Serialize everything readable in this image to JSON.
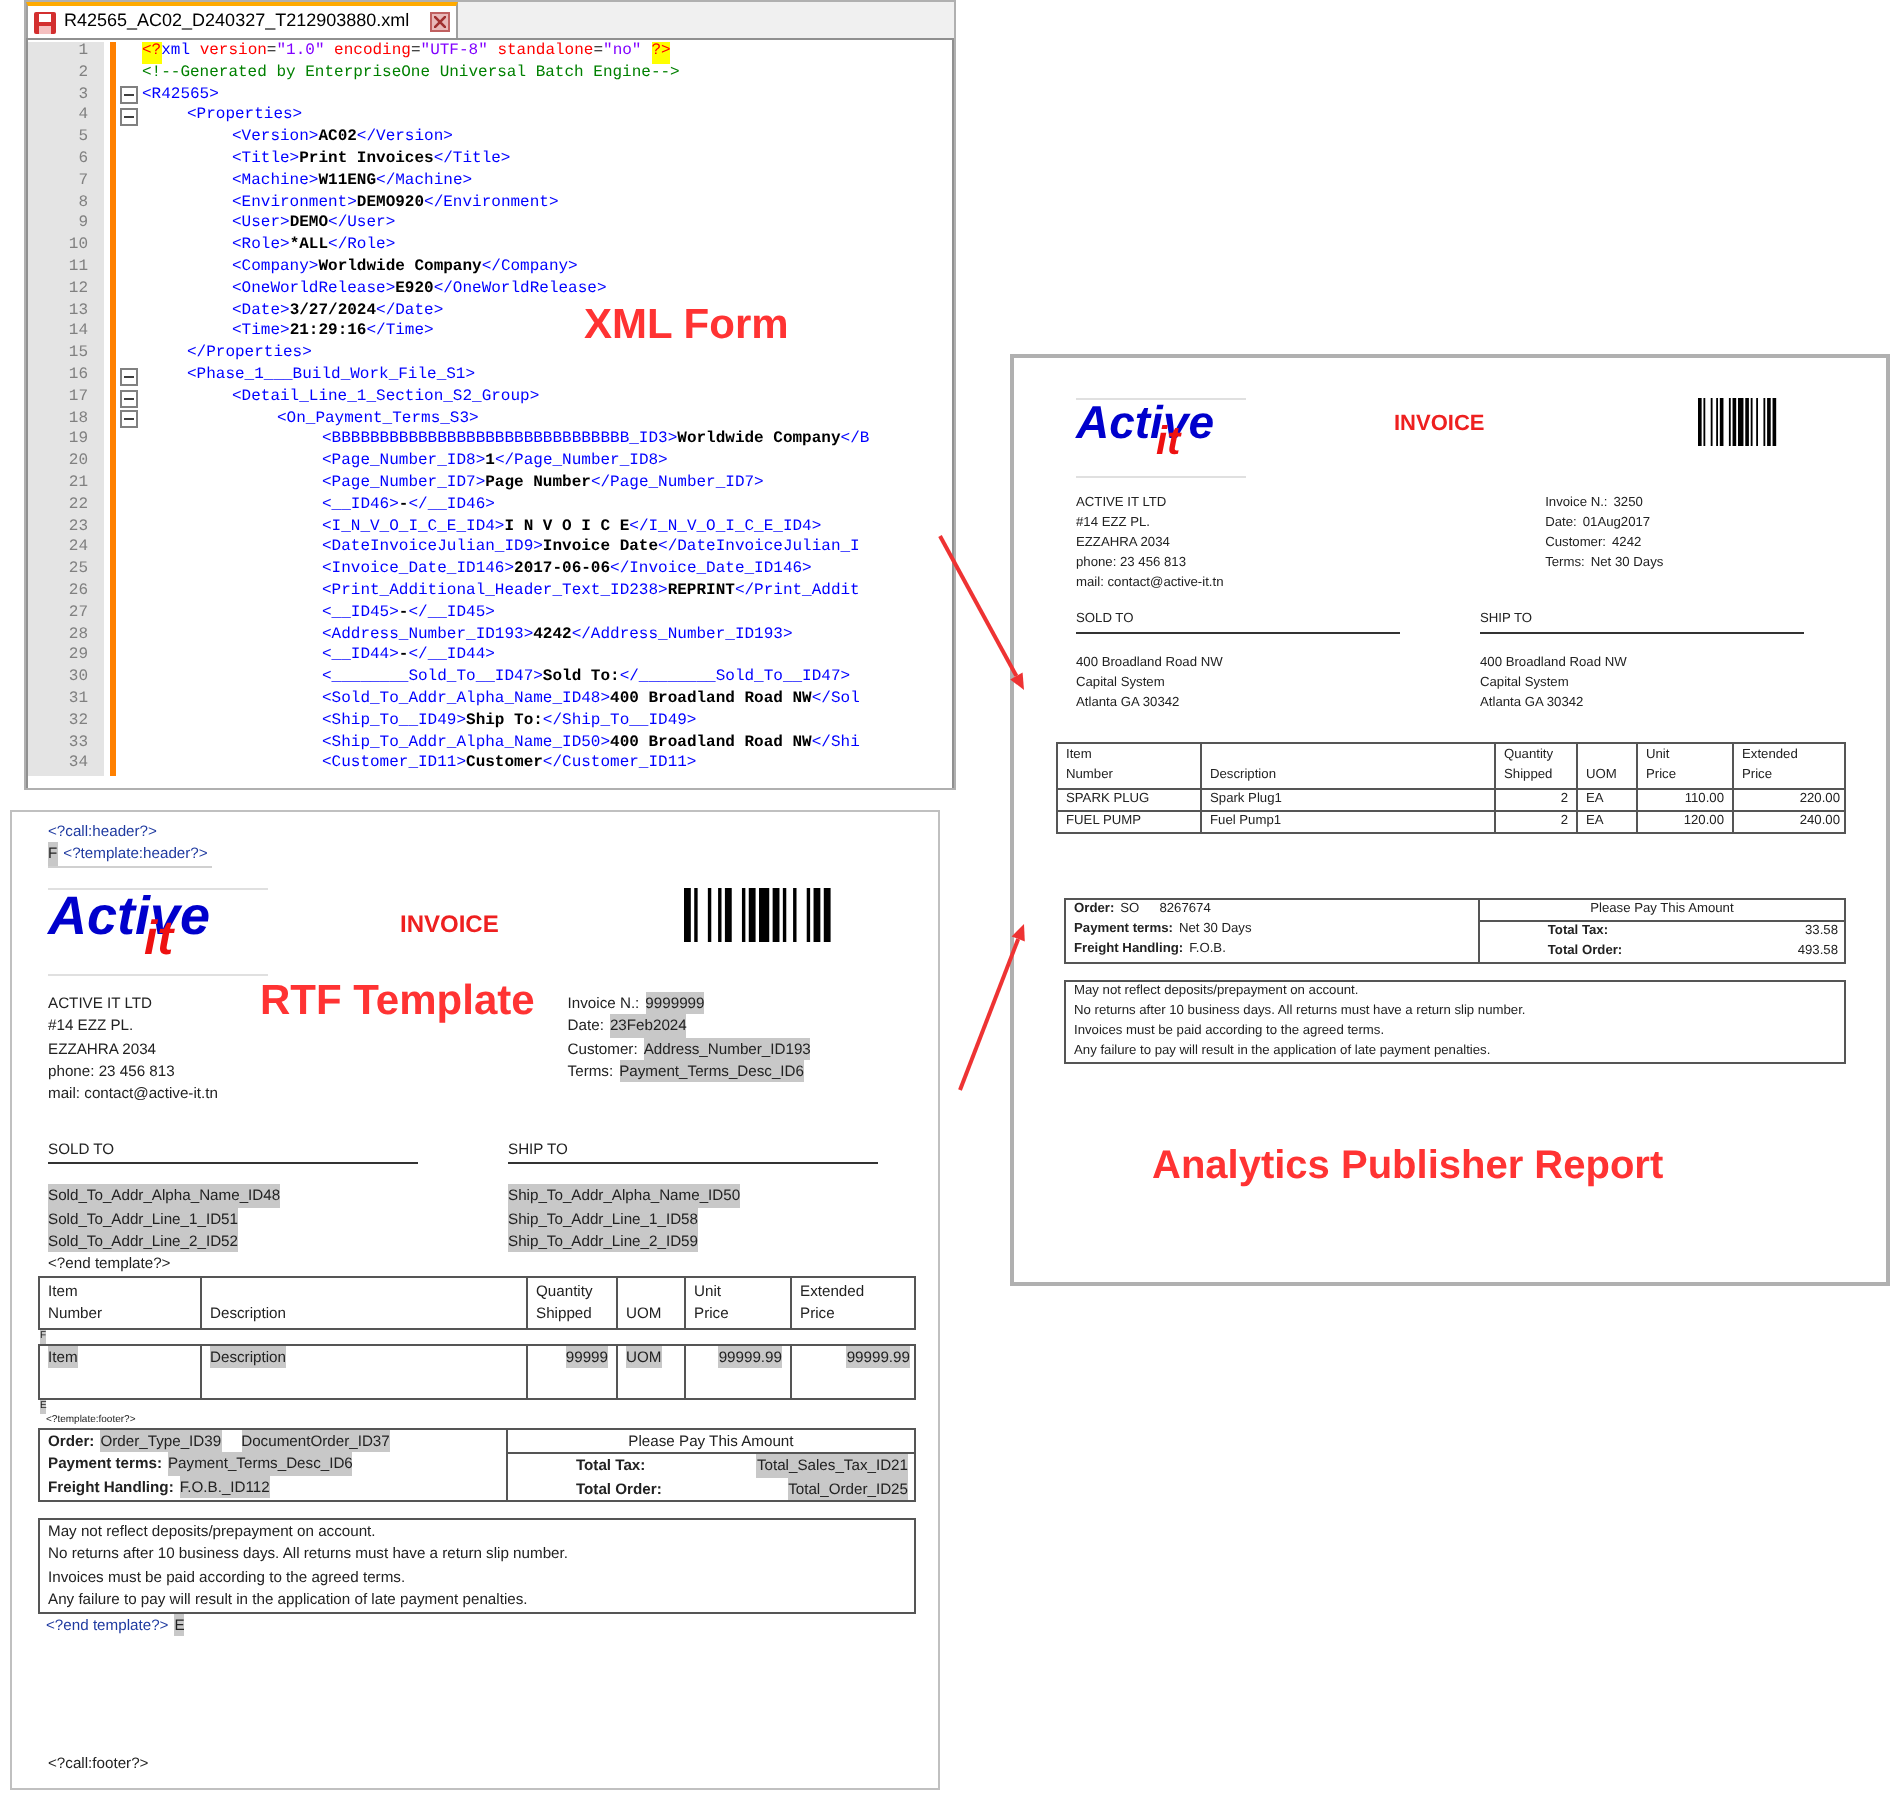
{
  "xml_editor": {
    "tab": {
      "title": "R42565_AC02_D240327_T212903880.xml",
      "selected": true
    },
    "overlay_label": "XML Form",
    "nodes": [
      {
        "number": "1",
        "kind": "decl",
        "open_mark": "<?",
        "name": "xml",
        "attributes": [
          {
            "name": "version",
            "equals": "=",
            "value": "\"1.0\""
          },
          {
            "name": "encoding",
            "equals": "=",
            "value": "\"UTF-8\""
          },
          {
            "name": "standalone",
            "equals": "=",
            "value": "\"no\""
          }
        ],
        "close_mark": "?>"
      },
      {
        "number": "2",
        "kind": "comment",
        "text": "<!--Generated by EnterpriseOne Universal Batch Engine-->"
      },
      {
        "number": "3",
        "kind": "element",
        "open": "<R42565>",
        "expanded": true,
        "children": [
          {
            "number": "4",
            "kind": "element",
            "open": "<Properties>",
            "expanded": true,
            "children": [
              {
                "number": "5",
                "kind": "element",
                "open": "<Version>",
                "text": "AC02",
                "close": "</Version>"
              },
              {
                "number": "6",
                "kind": "element",
                "open": "<Title>",
                "text": "Print Invoices",
                "close": "</Title>"
              },
              {
                "number": "7",
                "kind": "element",
                "open": "<Machine>",
                "text": "W11ENG",
                "close": "</Machine>"
              },
              {
                "number": "8",
                "kind": "element",
                "open": "<Environment>",
                "text": "DEMO920",
                "close": "</Environment>"
              },
              {
                "number": "9",
                "kind": "element",
                "open": "<User>",
                "text": "DEMO",
                "close": "</User>"
              },
              {
                "number": "10",
                "kind": "element",
                "open": "<Role>",
                "text": "*ALL",
                "close": "</Role>"
              },
              {
                "number": "11",
                "kind": "element",
                "open": "<Company>",
                "text": "Worldwide Company",
                "close": "</Company>"
              },
              {
                "number": "12",
                "kind": "element",
                "open": "<OneWorldRelease>",
                "text": "E920",
                "close": "</OneWorldRelease>"
              },
              {
                "number": "13",
                "kind": "element",
                "open": "<Date>",
                "text": "3/27/2024",
                "close": "</Date>"
              },
              {
                "number": "14",
                "kind": "element",
                "open": "<Time>",
                "text": "21:29:16",
                "close": "</Time>"
              }
            ],
            "end": {
              "number": "15",
              "text": "</Properties>"
            }
          },
          {
            "number": "16",
            "kind": "element",
            "open": "<Phase_1___Build_Work_File_S1>",
            "expanded": true,
            "children": [
              {
                "number": "17",
                "kind": "element",
                "open": "<Detail_Line_1_Section_S2_Group>",
                "expanded": true,
                "children": [
                  {
                    "number": "18",
                    "kind": "element",
                    "open": "<On_Payment_Terms_S3>",
                    "expanded": true,
                    "children": [
                      {
                        "number": "19",
                        "kind": "element",
                        "open": "<BBBBBBBBBBBBBBBBBBBBBBBBBBBBBBB_ID3>",
                        "text": "Worldwide Company",
                        "close": "</B"
                      },
                      {
                        "number": "20",
                        "kind": "element",
                        "open": "<Page_Number_ID8>",
                        "text": "1",
                        "close": "</Page_Number_ID8>"
                      },
                      {
                        "number": "21",
                        "kind": "element",
                        "open": "<Page_Number_ID7>",
                        "text": "Page Number",
                        "close": "</Page_Number_ID7>"
                      },
                      {
                        "number": "22",
                        "kind": "element",
                        "open": "<__ID46>",
                        "text": "-",
                        "close": "</__ID46>"
                      },
                      {
                        "number": "23",
                        "kind": "element",
                        "open": "<I_N_V_O_I_C_E_ID4>",
                        "text": "I N V O I C E",
                        "close": "</I_N_V_O_I_C_E_ID4>"
                      },
                      {
                        "number": "24",
                        "kind": "element",
                        "open": "<DateInvoiceJulian_ID9>",
                        "text": "Invoice Date",
                        "close": "</DateInvoiceJulian_I"
                      },
                      {
                        "number": "25",
                        "kind": "element",
                        "open": "<Invoice_Date_ID146>",
                        "text": "2017-06-06",
                        "close": "</Invoice_Date_ID146>"
                      },
                      {
                        "number": "26",
                        "kind": "element",
                        "open": "<Print_Additional_Header_Text_ID238>",
                        "text": "REPRINT",
                        "close": "</Print_Addit"
                      },
                      {
                        "number": "27",
                        "kind": "element",
                        "open": "<__ID45>",
                        "text": "-",
                        "close": "</__ID45>"
                      },
                      {
                        "number": "28",
                        "kind": "element",
                        "open": "<Address_Number_ID193>",
                        "text": "4242",
                        "close": "</Address_Number_ID193>"
                      },
                      {
                        "number": "29",
                        "kind": "element",
                        "open": "<__ID44>",
                        "text": "-",
                        "close": "</__ID44>"
                      },
                      {
                        "number": "30",
                        "kind": "element",
                        "open": "<________Sold_To__ID47>",
                        "text": "Sold To:",
                        "close": "</________Sold_To__ID47>"
                      },
                      {
                        "number": "31",
                        "kind": "element",
                        "open": "<Sold_To_Addr_Alpha_Name_ID48>",
                        "text": "400 Broadland Road NW",
                        "close": "</Sol"
                      },
                      {
                        "number": "32",
                        "kind": "element",
                        "open": "<Ship_To__ID49>",
                        "text": "Ship To:",
                        "close": "</Ship_To__ID49>"
                      },
                      {
                        "number": "33",
                        "kind": "element",
                        "open": "<Ship_To_Addr_Alpha_Name_ID50>",
                        "text": "400 Broadland Road NW",
                        "close": "</Shi"
                      },
                      {
                        "number": "34",
                        "kind": "element",
                        "open": "<Customer_ID11>",
                        "text": "Customer",
                        "close": "</Customer_ID11>"
                      }
                    ]
                  }
                ]
              }
            ]
          }
        ]
      }
    ]
  },
  "rtf_template": {
    "overlay_label": "RTF Template",
    "call_header": "<?call:header?>",
    "template_header": {
      "mark": "F",
      "tag": "<?template:header?>"
    },
    "logo": {
      "word": "Active",
      "sub": "it"
    },
    "heading": "INVOICE",
    "company_lines": [
      "ACTIVE IT LTD",
      "#14 EZZ PL.",
      "EZZAHRA 2034",
      "phone: 23 456 813",
      "mail: contact@active-it.tn"
    ],
    "info": [
      {
        "label": "Invoice N.:",
        "value": "9999999",
        "field": true
      },
      {
        "label": "Date:",
        "value": "23Feb2024",
        "field": true
      },
      {
        "label": "Customer:",
        "value": "Address_Number_ID193",
        "field": true
      },
      {
        "label": "Terms:",
        "value": "Payment_Terms_Desc_ID6",
        "field": true
      }
    ],
    "sold_to": {
      "heading": "SOLD TO",
      "lines": [
        {
          "text": "Sold_To_Addr_Alpha_Name_ID48",
          "field": true
        },
        {
          "text": "Sold_To_Addr_Line_1_ID51",
          "field": true
        },
        {
          "text": "Sold_To_Addr_Line_2_ID52",
          "field": true
        }
      ]
    },
    "ship_to": {
      "heading": "SHIP TO",
      "lines": [
        {
          "text": "Ship_To_Addr_Alpha_Name_ID50",
          "field": true
        },
        {
          "text": "Ship_To_Addr_Line_1_ID58",
          "field": true
        },
        {
          "text": "Ship_To_Addr_Line_2_ID59",
          "field": true
        }
      ]
    },
    "end_template": "<?end template?>",
    "columns": [
      {
        "lines": [
          "Item",
          "Number"
        ],
        "kind": "text"
      },
      {
        "lines": [
          "Description"
        ],
        "kind": "text"
      },
      {
        "lines": [
          "Quantity",
          "Shipped"
        ],
        "kind": "number"
      },
      {
        "lines": [
          "UOM"
        ],
        "kind": "text"
      },
      {
        "lines": [
          "Unit",
          "Price"
        ],
        "kind": "number"
      },
      {
        "lines": [
          "Extended",
          "Price"
        ],
        "kind": "number"
      }
    ],
    "row_start_mark": "F",
    "rows": [
      {
        "cells": [
          {
            "text": "Item",
            "field": true
          },
          {
            "text": "Description",
            "field": true
          },
          {
            "text": "99999",
            "field": true
          },
          {
            "text": "UOM",
            "field": true
          },
          {
            "text": "99999.99",
            "field": true
          },
          {
            "text": "99999.99",
            "field": true
          }
        ]
      }
    ],
    "row_end_mark": "E",
    "template_footer": "<?template:footer?>",
    "summary": {
      "order": {
        "label": "Order:",
        "values": [
          {
            "text": "Order_Type_ID39",
            "field": true
          },
          {
            "text": "DocumentOrder_ID37",
            "field": true
          }
        ]
      },
      "payment": {
        "label": "Payment terms:",
        "values": [
          {
            "text": "Payment_Terms_Desc_ID6",
            "field": true
          }
        ]
      },
      "freight": {
        "label": "Freight Handling:",
        "values": [
          {
            "text": "F.O.B._ID112",
            "field": true
          }
        ]
      },
      "pay_heading": "Please Pay This Amount",
      "totals": [
        {
          "label": "Total Tax:",
          "value": {
            "text": "Total_Sales_Tax_ID21",
            "field": true
          }
        },
        {
          "label": "Total Order:",
          "value": {
            "text": "Total_Order_ID25",
            "field": true
          }
        }
      ]
    },
    "notes": [
      "May not reflect deposits/prepayment on account.",
      "No returns after 10 business days. All returns must have a return slip number.",
      "Invoices must be paid according to the agreed terms.",
      "Any failure to pay will result in the application of late payment penalties."
    ],
    "end_template_footer": {
      "tag": "<?end template?>",
      "mark": "E"
    },
    "call_footer": "<?call:footer?>"
  },
  "report": {
    "overlay_label": "Analytics Publisher Report",
    "logo": {
      "word": "Active",
      "sub": "it"
    },
    "heading": "INVOICE",
    "company_lines": [
      "ACTIVE IT LTD",
      "#14 EZZ PL.",
      "EZZAHRA 2034",
      "phone: 23 456 813",
      "mail: contact@active-it.tn"
    ],
    "info": [
      {
        "label": "Invoice N.:",
        "value": "3250",
        "field": false
      },
      {
        "label": "Date:",
        "value": "01Aug2017",
        "field": false
      },
      {
        "label": "Customer:",
        "value": "4242",
        "field": false
      },
      {
        "label": "Terms:",
        "value": "Net 30 Days",
        "field": false
      }
    ],
    "sold_to": {
      "heading": "SOLD TO",
      "lines": [
        {
          "text": "400 Broadland Road NW",
          "field": false
        },
        {
          "text": "Capital System",
          "field": false
        },
        {
          "text": "Atlanta GA 30342",
          "field": false
        }
      ]
    },
    "ship_to": {
      "heading": "SHIP TO",
      "lines": [
        {
          "text": "400 Broadland Road NW",
          "field": false
        },
        {
          "text": "Capital System",
          "field": false
        },
        {
          "text": "Atlanta GA 30342",
          "field": false
        }
      ]
    },
    "columns": [
      {
        "lines": [
          "Item",
          "Number"
        ],
        "kind": "text"
      },
      {
        "lines": [
          "Description"
        ],
        "kind": "text"
      },
      {
        "lines": [
          "Quantity",
          "Shipped"
        ],
        "kind": "number"
      },
      {
        "lines": [
          "UOM"
        ],
        "kind": "text"
      },
      {
        "lines": [
          "Unit",
          "Price"
        ],
        "kind": "number"
      },
      {
        "lines": [
          "Extended",
          "Price"
        ],
        "kind": "number"
      }
    ],
    "rows": [
      {
        "cells": [
          {
            "text": "SPARK PLUG",
            "field": false
          },
          {
            "text": "Spark Plug1",
            "field": false
          },
          {
            "text": "2",
            "field": false
          },
          {
            "text": "EA",
            "field": false
          },
          {
            "text": "110.00",
            "field": false
          },
          {
            "text": "220.00",
            "field": false
          }
        ]
      },
      {
        "cells": [
          {
            "text": "FUEL PUMP",
            "field": false
          },
          {
            "text": "Fuel Pump1",
            "field": false
          },
          {
            "text": "2",
            "field": false
          },
          {
            "text": "EA",
            "field": false
          },
          {
            "text": "120.00",
            "field": false
          },
          {
            "text": "240.00",
            "field": false
          }
        ]
      }
    ],
    "summary": {
      "order": {
        "label": "Order:",
        "values": [
          {
            "text": "SO",
            "field": false
          },
          {
            "text": "8267674",
            "field": false
          }
        ]
      },
      "payment": {
        "label": "Payment terms:",
        "values": [
          {
            "text": "Net 30 Days",
            "field": false
          }
        ]
      },
      "freight": {
        "label": "Freight Handling:",
        "values": [
          {
            "text": "F.O.B.",
            "field": false
          }
        ]
      },
      "pay_heading": "Please Pay This Amount",
      "totals": [
        {
          "label": "Total Tax:",
          "value": {
            "text": "33.58",
            "field": false
          }
        },
        {
          "label": "Total Order:",
          "value": {
            "text": "493.58",
            "field": false
          }
        }
      ]
    },
    "notes": [
      "May not reflect deposits/prepayment on account.",
      "No returns after 10 business days. All returns must have a return slip number.",
      "Invoices must be paid according to the agreed terms.",
      "Any failure to pay will result in the application of late payment penalties."
    ]
  }
}
